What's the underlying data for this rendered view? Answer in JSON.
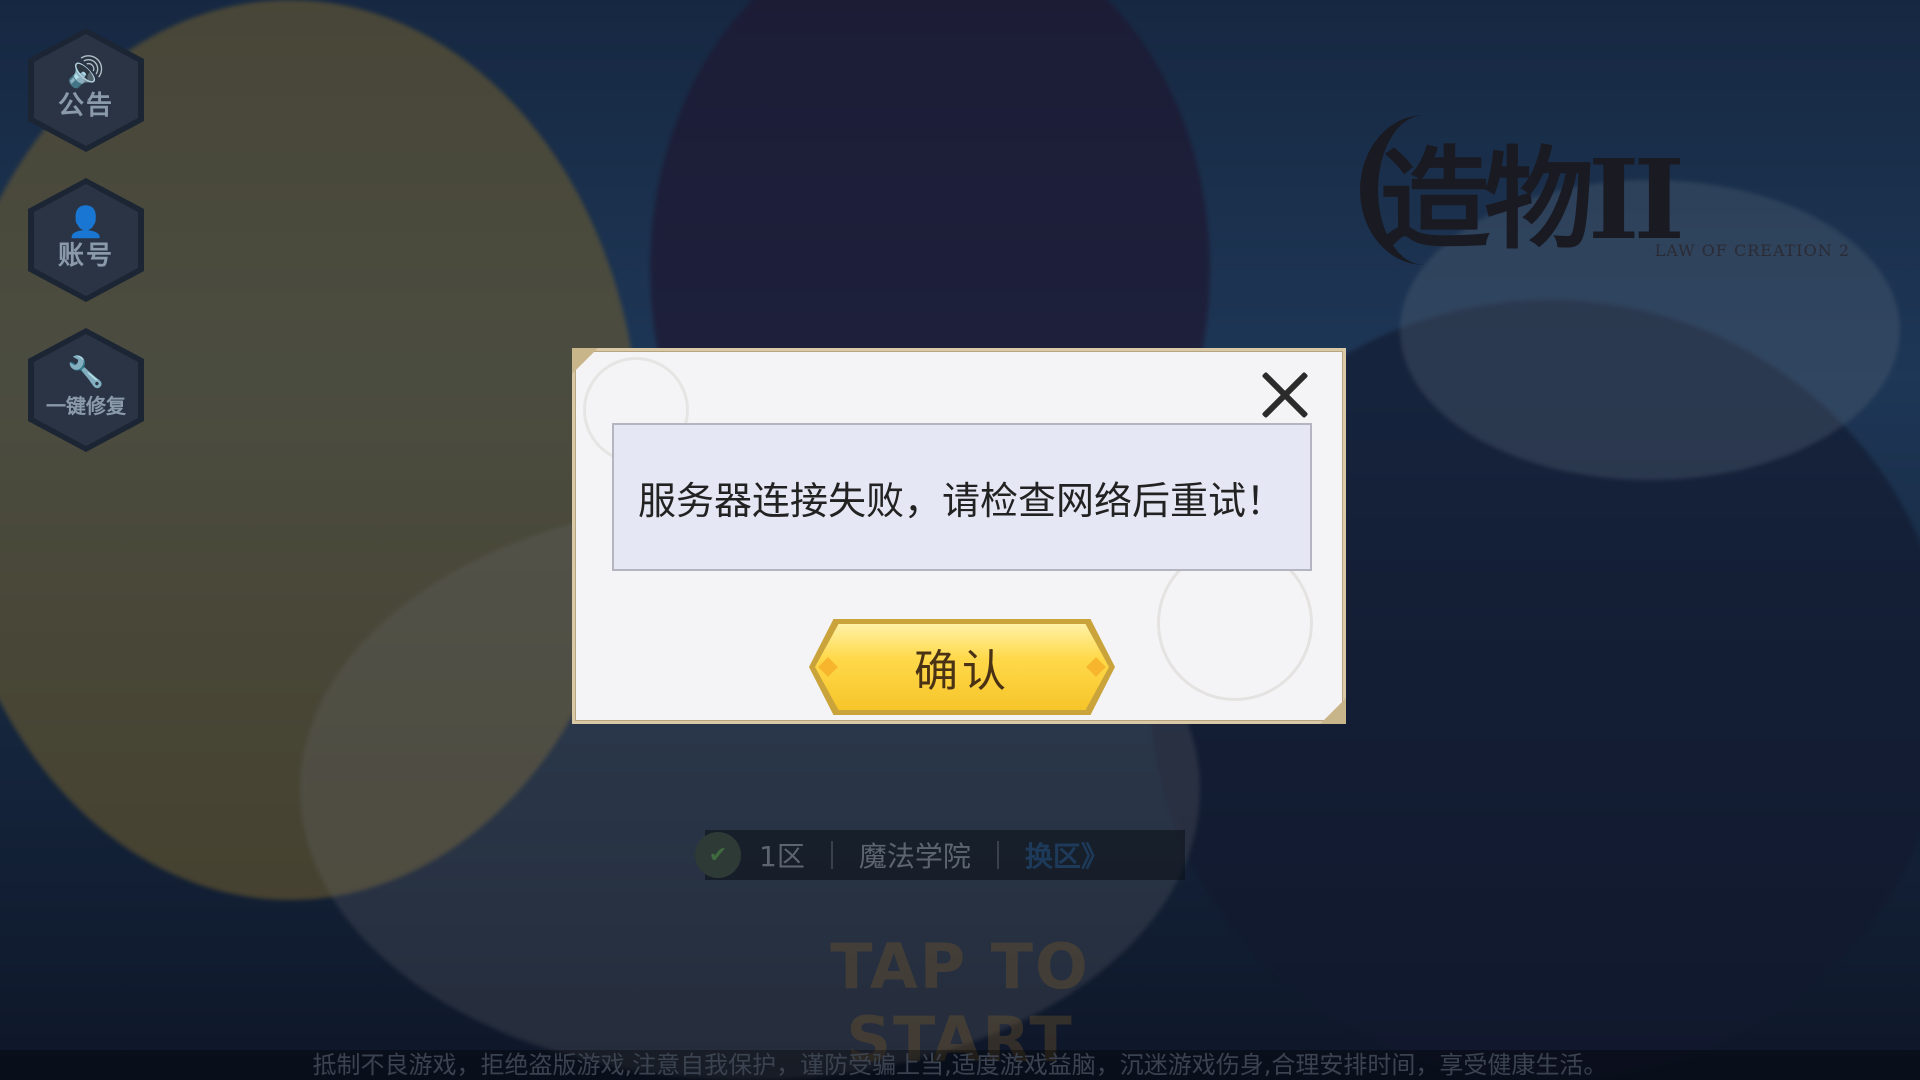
{
  "side_menu": [
    {
      "icon": "speaker-icon",
      "glyph": "🔊",
      "label": "公告"
    },
    {
      "icon": "user-icon",
      "glyph": "👤",
      "label": "账号"
    },
    {
      "icon": "wrench-icon",
      "glyph": "🔧",
      "label": "一键修复"
    }
  ],
  "logo": {
    "title": "造物II",
    "subtitle": "LAW OF CREATION 2"
  },
  "server": {
    "zone": "1区",
    "name": "魔法学院",
    "change_label": "换区》"
  },
  "tap_to_start": "TAP TO START",
  "notice": "抵制不良游戏，拒绝盗版游戏,注意自我保护，谨防受骗上当,适度游戏益脑，沉迷游戏伤身,合理安排时间，享受健康生活。",
  "dialog": {
    "message": "服务器连接失败，请检查网络后重试！",
    "confirm_label": "确认"
  },
  "colors": {
    "dialog_bg": "#f4f4f6",
    "message_bg": "#e6e7f4",
    "button_gold": "#ffd94a"
  }
}
